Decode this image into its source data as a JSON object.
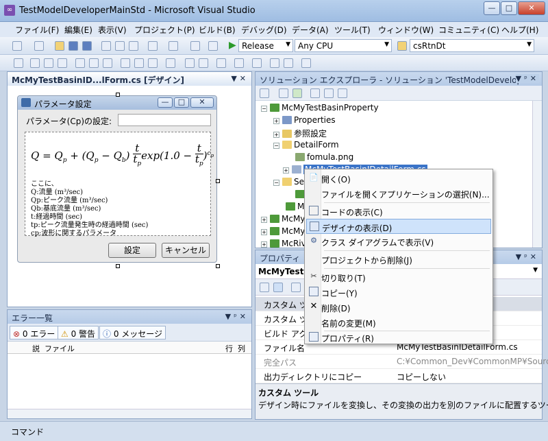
{
  "window": {
    "title": "TestModelDeveloperMainStd - Microsoft Visual Studio",
    "btn_min": "—",
    "btn_max": "□",
    "btn_close": "✕"
  },
  "menu": [
    "ファイル(F)",
    "編集(E)",
    "表示(V)",
    "プロジェクト(P)",
    "ビルド(B)",
    "デバッグ(D)",
    "データ(A)",
    "ツール(T)",
    "ウィンドウ(W)",
    "コミュニティ(C)",
    "ヘルプ(H)"
  ],
  "toolbar": {
    "config": "Release",
    "platform": "Any CPU",
    "find": "csRtnDt"
  },
  "designer": {
    "tab": "McMyTestBasinID...lForm.cs [デザイン]",
    "form_title": "パラメータ設定",
    "param_label": "パラメータ(Cp)の設定:",
    "param_value": "",
    "formula": {
      "lhs": "Q = Q",
      "sub_p": "p",
      "plus": " + (Q",
      "sub_p2": "p",
      "minus": " − Q",
      "sub_b": "b",
      "close": ")",
      "frac_top": "t",
      "frac_bot": "t",
      "frac_bot_sub": "p",
      "mid": "exp(1.0 − ",
      "frac2_top": "t",
      "frac2_bot": "t",
      "frac2_bot_sub": "p",
      "end": ")",
      "sup": "c",
      "sup_sub": "p"
    },
    "desc": [
      "ここに、",
      "Q:流量 (m³/sec)",
      "Qp:ピーク流量 (m³/sec)",
      "Qb:基底流量 (m³/sec)",
      "t:経過時間 (sec)",
      "tp:ピーク流量発生時の経過時間 (sec)",
      "cp:波形に関するパラメータ"
    ],
    "ok": "設定",
    "cancel": "キャンセル"
  },
  "errors": {
    "title": "エラー一覧",
    "errors_btn": "0 エラー",
    "warnings_btn": "0 警告",
    "messages_btn": "0 メッセージ",
    "col_desc": "説",
    "col_file": "ファイル",
    "col_line": "行",
    "col_col": "列"
  },
  "solution": {
    "title": "ソリューション エクスプローラ - ソリューション 'TestModelDevelope...",
    "nodes": [
      "McMyTestBasinProperty",
      "Properties",
      "参照設定",
      "DetailForm",
      "fomula.png",
      "McMyTestBasinIDetailForm.cs",
      "Se",
      "c",
      "M",
      "McMy",
      "McMy",
      "McRiv"
    ]
  },
  "properties": {
    "title": "プロパティ",
    "object": "McMyTestBa",
    "rows": [
      {
        "k": "カスタム ツ",
        "v": ""
      },
      {
        "k": "カスタム ツ",
        "v": ""
      },
      {
        "k": "ビルド アク",
        "v": ""
      },
      {
        "k": "ファイル名",
        "v": "McMyTestBasinIDetailForm.cs"
      },
      {
        "k": "完全パス",
        "v": "C:¥Common_Dev¥CommonMP¥Source¥"
      },
      {
        "k": "出力ディレクトリにコピー",
        "v": "コピーしない"
      }
    ],
    "desc_title": "カスタム ツール",
    "desc_text": "デザイン時にファイルを変換し、その変換の出力を別のファイルに配置するツー..."
  },
  "context_menu": [
    {
      "label": "開く(O)",
      "icon": "open-icon"
    },
    {
      "label": "ファイルを開くアプリケーションの選択(N)...",
      "icon": ""
    },
    {
      "label": "コードの表示(C)",
      "icon": "code-icon"
    },
    {
      "label": "デザイナの表示(D)",
      "icon": "designer-icon"
    },
    {
      "label": "クラス ダイアグラムで表示(V)",
      "icon": "class-diagram-icon"
    },
    {
      "label": "プロジェクトから削除(J)",
      "icon": ""
    },
    {
      "label": "切り取り(T)",
      "icon": "cut-icon"
    },
    {
      "label": "コピー(Y)",
      "icon": "copy-icon"
    },
    {
      "label": "削除(D)",
      "icon": "delete-icon"
    },
    {
      "label": "名前の変更(M)",
      "icon": ""
    },
    {
      "label": "プロパティ(R)",
      "icon": "properties-icon"
    }
  ],
  "statusbar": {
    "text": "コマンド"
  }
}
